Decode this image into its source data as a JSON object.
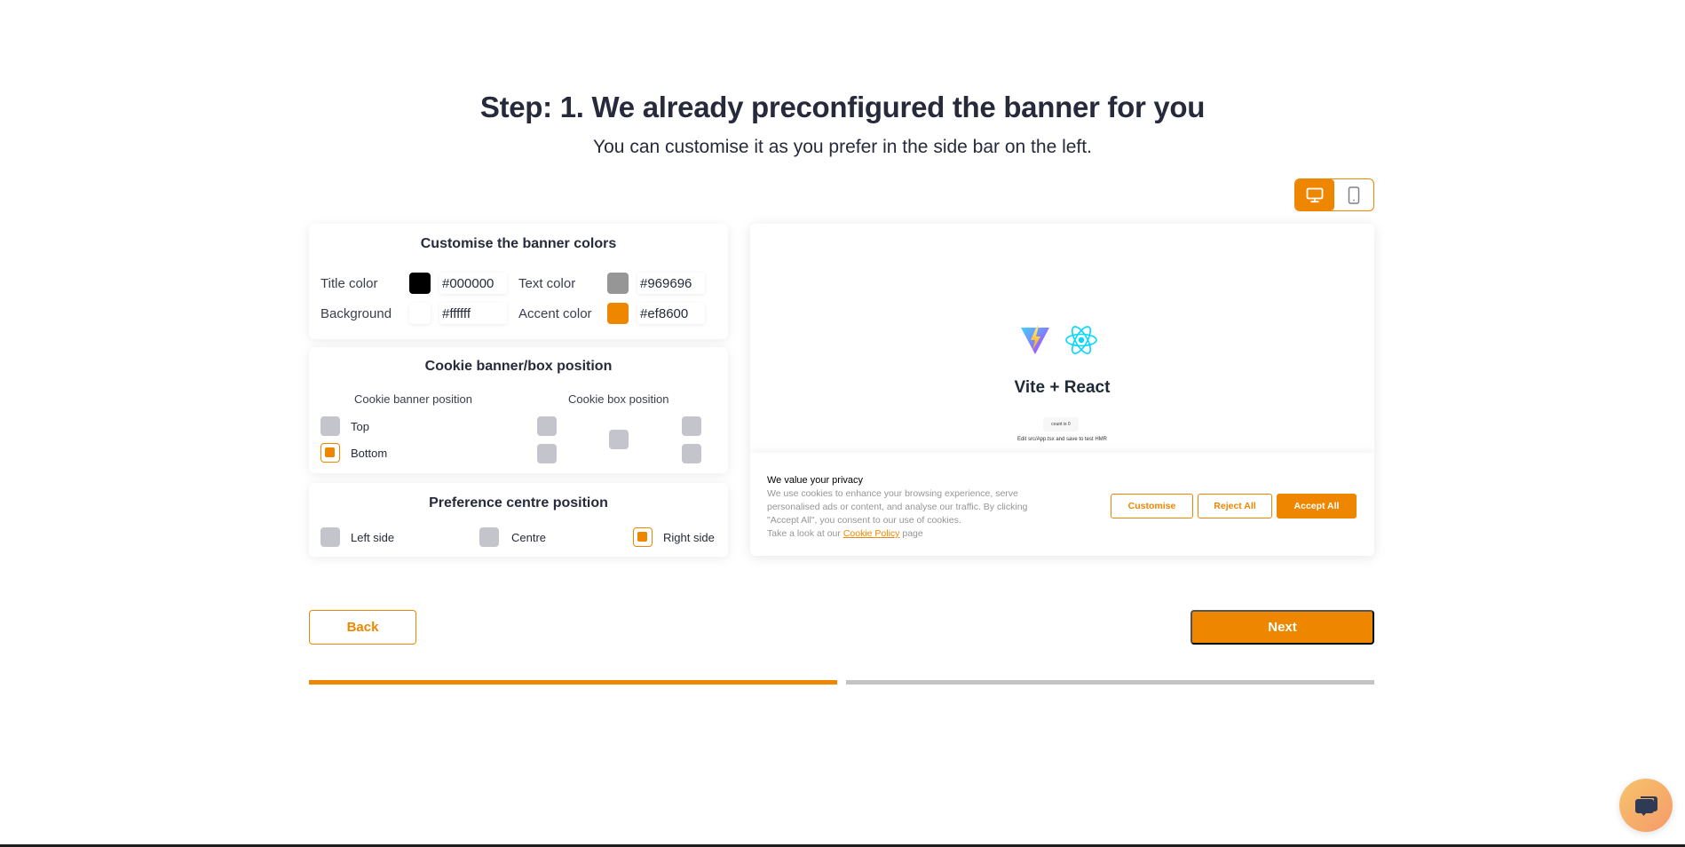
{
  "header": {
    "title": "Step: 1. We already preconfigured the banner for you",
    "subtitle": "You can customise it as you prefer in the side bar on the left."
  },
  "device_toggle": {
    "options": [
      {
        "icon": "desktop-icon",
        "active": true
      },
      {
        "icon": "mobile-icon",
        "active": false
      }
    ]
  },
  "colors_card": {
    "title": "Customise the banner colors",
    "fields": [
      {
        "label": "Title color",
        "value": "#000000",
        "swatch": "#000000"
      },
      {
        "label": "Text color",
        "value": "#969696",
        "swatch": "#969696"
      },
      {
        "label": "Background",
        "value": "#ffffff",
        "swatch": "#ffffff"
      },
      {
        "label": "Accent color",
        "value": "#ef8600",
        "swatch": "#ef8600"
      }
    ]
  },
  "position_card": {
    "title": "Cookie banner/box position",
    "banner_heading": "Cookie banner position",
    "box_heading": "Cookie box position",
    "banner_options": [
      {
        "label": "Top",
        "selected": false
      },
      {
        "label": "Bottom",
        "selected": true
      }
    ],
    "box_options": [
      "top-left",
      "bottom-left",
      "center",
      "top-right",
      "bottom-right"
    ]
  },
  "pref_card": {
    "title": "Preference centre position",
    "options": [
      {
        "label": "Left side",
        "selected": false
      },
      {
        "label": "Centre",
        "selected": false
      },
      {
        "label": "Right side",
        "selected": true
      }
    ]
  },
  "preview": {
    "app_title": "Vite + React",
    "count_label": "count is 0",
    "hmr_text": "Edit src/App.tsx and save to test HMR",
    "cookie_banner": {
      "title": "We value your privacy",
      "body": "We use cookies to enhance your browsing experience, serve personalised ads or content, and analyse our traffic. By clicking \"Accept All\", you consent to our use of cookies.",
      "policy_prefix": "Take a look at our",
      "policy_link": "Cookie Policy",
      "policy_suffix": "page",
      "buttons": {
        "customise": "Customise",
        "reject": "Reject All",
        "accept": "Accept All"
      }
    }
  },
  "nav": {
    "back": "Back",
    "next": "Next"
  },
  "progress": {
    "steps_total": 2,
    "steps_completed": 1
  },
  "colors": {
    "accent": "#ef8600",
    "title_text": "#262a3b",
    "inactive_box": "#c4c4cc"
  }
}
